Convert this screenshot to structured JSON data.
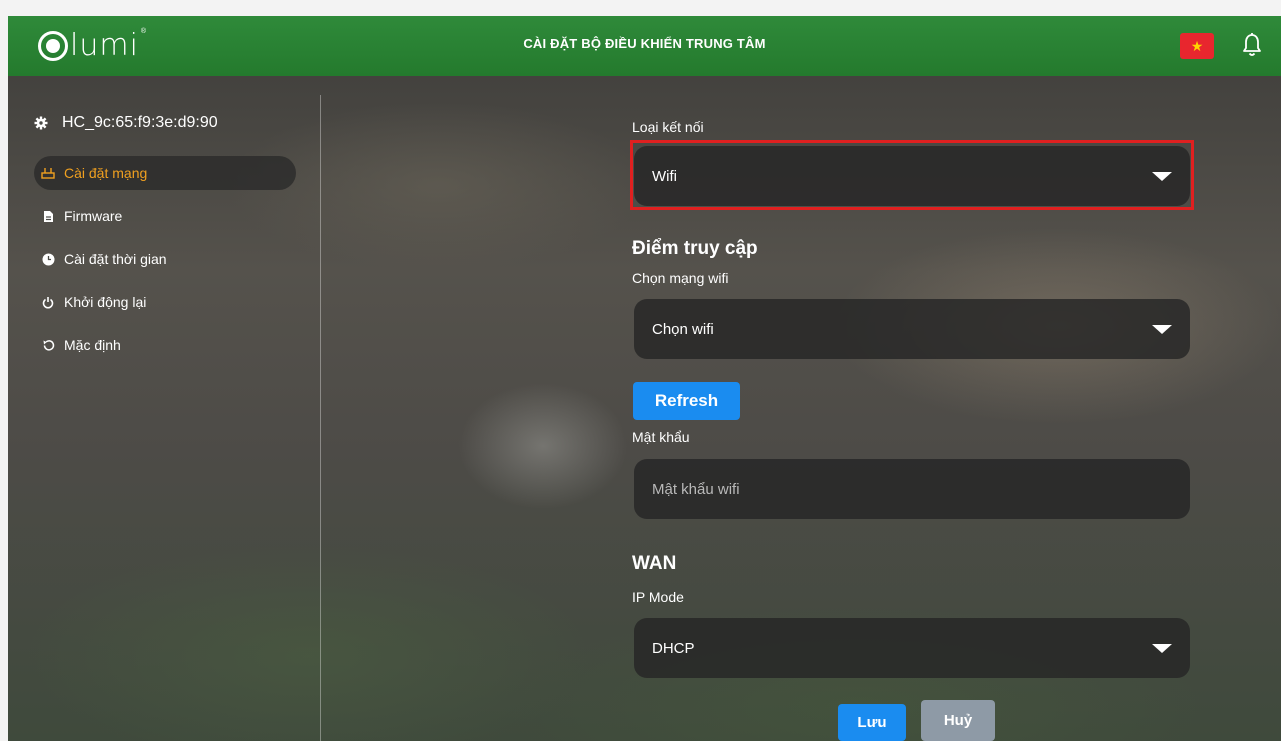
{
  "header": {
    "logo_text": "lumi",
    "title": "CÀI ĐẶT BỘ ĐIỀU KHIỂN TRUNG TÂM",
    "flag_icon": "vietnam-flag-icon",
    "notification_icon": "bell-icon"
  },
  "sidebar": {
    "device_name": "HC_9c:65:f9:3e:d9:90",
    "items": [
      {
        "label": "Cài đặt mạng",
        "icon": "network-icon",
        "active": true
      },
      {
        "label": "Firmware",
        "icon": "file-icon",
        "active": false
      },
      {
        "label": "Cài đặt thời gian",
        "icon": "clock-icon",
        "active": false
      },
      {
        "label": "Khởi động lại",
        "icon": "power-icon",
        "active": false
      },
      {
        "label": "Mặc định",
        "icon": "reset-icon",
        "active": false
      }
    ]
  },
  "form": {
    "connection_type_label": "Loại kết nối",
    "connection_type_value": "Wifi",
    "access_point_heading": "Điểm truy cập",
    "wifi_select_label": "Chọn mạng wifi",
    "wifi_select_value": "Chọn wifi",
    "refresh_label": "Refresh",
    "password_label": "Mật khẩu",
    "password_placeholder": "Mật khẩu wifi",
    "wan_heading": "WAN",
    "ip_mode_label": "IP Mode",
    "ip_mode_value": "DHCP",
    "save_label": "Lưu",
    "cancel_label": "Huỷ"
  },
  "colors": {
    "header_green": "#2f8a3a",
    "accent_orange": "#f0a020",
    "primary_blue": "#1a8cf0",
    "cancel_gray": "#8e9aa6",
    "highlight_red": "#e02020"
  }
}
